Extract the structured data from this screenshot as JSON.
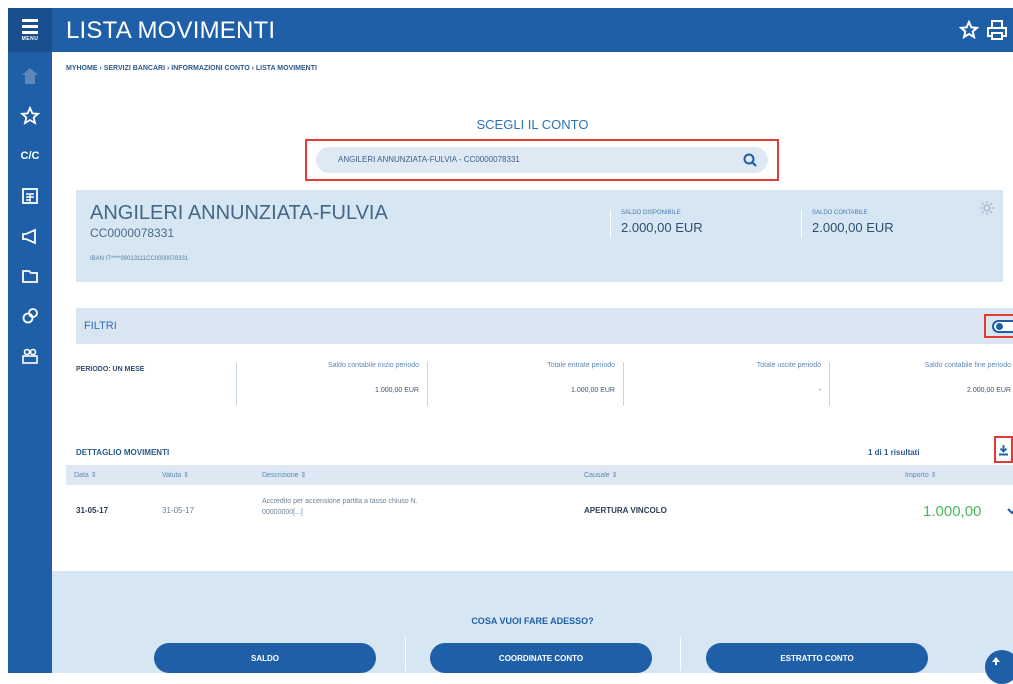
{
  "sidebar": {
    "menu_label": "MENU",
    "cc_label": "C/C"
  },
  "header": {
    "title": "LISTA MOVIMENTI"
  },
  "breadcrumb": "MYHOME › SERVIZI BANCARI › INFORMAZIONI CONTO › LISTA MOVIMENTI",
  "account_selector": {
    "label": "SCEGLI IL CONTO",
    "value": "ANGILERI ANNUNZIATA-FULVIA - CC0000078331"
  },
  "account": {
    "holder": "ANGILERI ANNUNZIATA-FULVIA",
    "code": "CC0000078331",
    "iban": "IBAN IT****99013111CC0000078331",
    "saldo_disponibile_label": "SALDO DISPONIBILE",
    "saldo_disponibile_value": "2.000,00 EUR",
    "saldo_contabile_label": "SALDO CONTABILE",
    "saldo_contabile_value": "2.000,00 EUR"
  },
  "filters": {
    "label": "FILTRI"
  },
  "summary": {
    "periodo": "PERIODO: UN MESE",
    "cols": [
      {
        "label": "Saldo contabile inizio periodo",
        "value": "1.000,00 EUR"
      },
      {
        "label": "Totale entrate periodo",
        "value": "1.000,00 EUR"
      },
      {
        "label": "Totale uscite periodo",
        "value": "-"
      },
      {
        "label": "Saldo contabile fine periodo",
        "value": "2.000,00 EUR"
      }
    ]
  },
  "movements": {
    "title": "DETTAGLIO MOVIMENTI",
    "results": "1 di 1 risultati",
    "columns": {
      "data": "Data ⇕",
      "valuta": "Valuta ⇕",
      "descrizione": "Descrizione ⇕",
      "causale": "Causale ⇕",
      "importo": "Importo ⇕"
    },
    "rows": [
      {
        "data": "31-05-17",
        "valuta": "31-05-17",
        "descrizione_1": "Accredito per accensione partita a tasso chiuso N.",
        "descrizione_2": "00000000[...]",
        "causale": "APERTURA VINCOLO",
        "importo": "1.000,00"
      }
    ]
  },
  "footer": {
    "question": "COSA VUOI FARE ADESSO?",
    "buttons": [
      "SALDO",
      "COORDINATE CONTO",
      "ESTRATTO CONTO"
    ]
  },
  "colors": {
    "brand": "#1f5fa8",
    "card": "#d6e6f2",
    "positive_amount": "#47b95c",
    "highlight": "#e53935"
  }
}
